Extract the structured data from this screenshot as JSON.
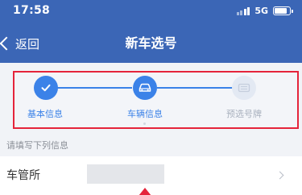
{
  "status_bar": {
    "time": "17:58",
    "network": "5G",
    "icons": [
      "signal-icon",
      "battery-icon"
    ]
  },
  "nav": {
    "back_label": "返回",
    "title": "新车选号",
    "back_icon": "chevron-left-icon"
  },
  "steps": [
    {
      "label": "基本信息",
      "state": "done",
      "icon": "check-icon"
    },
    {
      "label": "车辆信息",
      "state": "current",
      "icon": "car-icon"
    },
    {
      "label": "预选号牌",
      "state": "pending",
      "icon": "license-plate-icon"
    }
  ],
  "form": {
    "hint": "请填写下列信息",
    "rows": [
      {
        "label": "车管所",
        "value": ""
      }
    ]
  },
  "colors": {
    "header": "#3b66b6",
    "accent": "#3b82e8",
    "highlight": "#e5243b",
    "pending": "#a9b1be",
    "background": "#f1f3f7"
  }
}
